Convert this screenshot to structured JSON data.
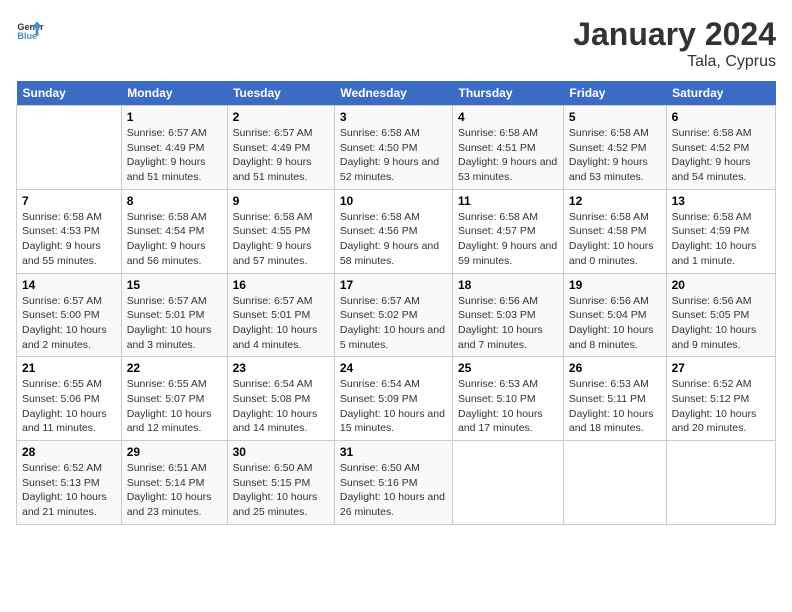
{
  "logo": {
    "line1": "General",
    "line2": "Blue"
  },
  "title": "January 2024",
  "subtitle": "Tala, Cyprus",
  "headers": [
    "Sunday",
    "Monday",
    "Tuesday",
    "Wednesday",
    "Thursday",
    "Friday",
    "Saturday"
  ],
  "weeks": [
    [
      {
        "day": "",
        "sunrise": "",
        "sunset": "",
        "daylight": ""
      },
      {
        "day": "1",
        "sunrise": "6:57 AM",
        "sunset": "4:49 PM",
        "daylight": "9 hours and 51 minutes."
      },
      {
        "day": "2",
        "sunrise": "6:57 AM",
        "sunset": "4:49 PM",
        "daylight": "9 hours and 51 minutes."
      },
      {
        "day": "3",
        "sunrise": "6:58 AM",
        "sunset": "4:50 PM",
        "daylight": "9 hours and 52 minutes."
      },
      {
        "day": "4",
        "sunrise": "6:58 AM",
        "sunset": "4:51 PM",
        "daylight": "9 hours and 53 minutes."
      },
      {
        "day": "5",
        "sunrise": "6:58 AM",
        "sunset": "4:52 PM",
        "daylight": "9 hours and 53 minutes."
      },
      {
        "day": "6",
        "sunrise": "6:58 AM",
        "sunset": "4:52 PM",
        "daylight": "9 hours and 54 minutes."
      }
    ],
    [
      {
        "day": "7",
        "sunrise": "6:58 AM",
        "sunset": "4:53 PM",
        "daylight": "9 hours and 55 minutes."
      },
      {
        "day": "8",
        "sunrise": "6:58 AM",
        "sunset": "4:54 PM",
        "daylight": "9 hours and 56 minutes."
      },
      {
        "day": "9",
        "sunrise": "6:58 AM",
        "sunset": "4:55 PM",
        "daylight": "9 hours and 57 minutes."
      },
      {
        "day": "10",
        "sunrise": "6:58 AM",
        "sunset": "4:56 PM",
        "daylight": "9 hours and 58 minutes."
      },
      {
        "day": "11",
        "sunrise": "6:58 AM",
        "sunset": "4:57 PM",
        "daylight": "9 hours and 59 minutes."
      },
      {
        "day": "12",
        "sunrise": "6:58 AM",
        "sunset": "4:58 PM",
        "daylight": "10 hours and 0 minutes."
      },
      {
        "day": "13",
        "sunrise": "6:58 AM",
        "sunset": "4:59 PM",
        "daylight": "10 hours and 1 minute."
      }
    ],
    [
      {
        "day": "14",
        "sunrise": "6:57 AM",
        "sunset": "5:00 PM",
        "daylight": "10 hours and 2 minutes."
      },
      {
        "day": "15",
        "sunrise": "6:57 AM",
        "sunset": "5:01 PM",
        "daylight": "10 hours and 3 minutes."
      },
      {
        "day": "16",
        "sunrise": "6:57 AM",
        "sunset": "5:01 PM",
        "daylight": "10 hours and 4 minutes."
      },
      {
        "day": "17",
        "sunrise": "6:57 AM",
        "sunset": "5:02 PM",
        "daylight": "10 hours and 5 minutes."
      },
      {
        "day": "18",
        "sunrise": "6:56 AM",
        "sunset": "5:03 PM",
        "daylight": "10 hours and 7 minutes."
      },
      {
        "day": "19",
        "sunrise": "6:56 AM",
        "sunset": "5:04 PM",
        "daylight": "10 hours and 8 minutes."
      },
      {
        "day": "20",
        "sunrise": "6:56 AM",
        "sunset": "5:05 PM",
        "daylight": "10 hours and 9 minutes."
      }
    ],
    [
      {
        "day": "21",
        "sunrise": "6:55 AM",
        "sunset": "5:06 PM",
        "daylight": "10 hours and 11 minutes."
      },
      {
        "day": "22",
        "sunrise": "6:55 AM",
        "sunset": "5:07 PM",
        "daylight": "10 hours and 12 minutes."
      },
      {
        "day": "23",
        "sunrise": "6:54 AM",
        "sunset": "5:08 PM",
        "daylight": "10 hours and 14 minutes."
      },
      {
        "day": "24",
        "sunrise": "6:54 AM",
        "sunset": "5:09 PM",
        "daylight": "10 hours and 15 minutes."
      },
      {
        "day": "25",
        "sunrise": "6:53 AM",
        "sunset": "5:10 PM",
        "daylight": "10 hours and 17 minutes."
      },
      {
        "day": "26",
        "sunrise": "6:53 AM",
        "sunset": "5:11 PM",
        "daylight": "10 hours and 18 minutes."
      },
      {
        "day": "27",
        "sunrise": "6:52 AM",
        "sunset": "5:12 PM",
        "daylight": "10 hours and 20 minutes."
      }
    ],
    [
      {
        "day": "28",
        "sunrise": "6:52 AM",
        "sunset": "5:13 PM",
        "daylight": "10 hours and 21 minutes."
      },
      {
        "day": "29",
        "sunrise": "6:51 AM",
        "sunset": "5:14 PM",
        "daylight": "10 hours and 23 minutes."
      },
      {
        "day": "30",
        "sunrise": "6:50 AM",
        "sunset": "5:15 PM",
        "daylight": "10 hours and 25 minutes."
      },
      {
        "day": "31",
        "sunrise": "6:50 AM",
        "sunset": "5:16 PM",
        "daylight": "10 hours and 26 minutes."
      },
      {
        "day": "",
        "sunrise": "",
        "sunset": "",
        "daylight": ""
      },
      {
        "day": "",
        "sunrise": "",
        "sunset": "",
        "daylight": ""
      },
      {
        "day": "",
        "sunrise": "",
        "sunset": "",
        "daylight": ""
      }
    ]
  ],
  "labels": {
    "sunrise_prefix": "Sunrise:",
    "sunset_prefix": "Sunset:",
    "daylight_prefix": "Daylight:"
  }
}
